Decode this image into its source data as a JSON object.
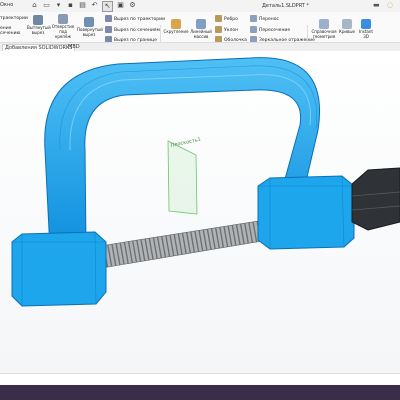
{
  "titlebar": {
    "menu_label": "Окно",
    "document_title": "Деталь1.SLDPRT *"
  },
  "ribbon": {
    "col1": [
      "траектории",
      "",
      "ение",
      "сечению"
    ],
    "hole_wizard": "Отверстие под крепёж",
    "extrude_cut": "Вытянутый вырез",
    "revolve_cut": "Повернутый вырез",
    "sweep_cut": "Вырез по траектории",
    "loft_cut": "Вырез по сечениям",
    "boundary_cut": "Вырез по границе",
    "fillet": "Скругление",
    "linear_pattern": "Линейный массив",
    "rib": "Ребро",
    "draft": "Уклон",
    "shell": "Оболочка",
    "wrap": "Перенос",
    "intersect": "Пересечение",
    "mirror": "Зеркальное отражение",
    "reference_geometry": "Справочная геометрия",
    "curves": "Кривые",
    "instant3d": "Instant 3D"
  },
  "tabs": [
    {
      "label": "Добавления SOLIDWORKS",
      "active": true
    },
    {
      "label": "MBD",
      "active": false
    }
  ],
  "viewport": {
    "plane_label": "Плоскость1"
  },
  "colors": {
    "part_blue": "#1ea9ee",
    "part_blue_dark": "#0d7fd0",
    "screw_gray": "#a9acaf",
    "handle_dark": "#2d2f33",
    "plane_green": "#6cc46c"
  }
}
